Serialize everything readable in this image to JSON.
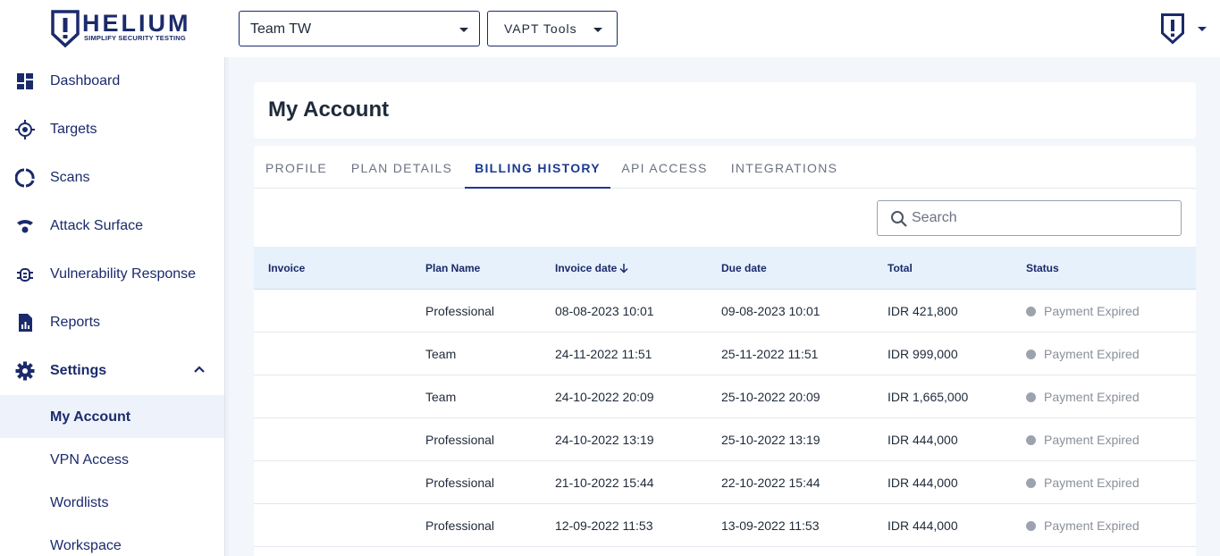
{
  "header": {
    "logo": {
      "word": "HELIUM",
      "tagline": "SIMPLIFY SECURITY TESTING"
    },
    "team_select": {
      "value": "Team TW"
    },
    "tools_select": {
      "value": "VAPT Tools"
    },
    "colors": {
      "brand": "#1b2a6b",
      "accent": "#1b3a8f"
    }
  },
  "sidebar": {
    "items": [
      {
        "label": "Dashboard",
        "icon": "dashboard-icon"
      },
      {
        "label": "Targets",
        "icon": "target-icon"
      },
      {
        "label": "Scans",
        "icon": "scans-icon"
      },
      {
        "label": "Attack Surface",
        "icon": "attack-surface-icon"
      },
      {
        "label": "Vulnerability Response",
        "icon": "bug-icon"
      },
      {
        "label": "Reports",
        "icon": "reports-icon"
      },
      {
        "label": "Settings",
        "icon": "gear-icon",
        "expanded": true
      }
    ],
    "settings_children": [
      {
        "label": "My Account",
        "active": true
      },
      {
        "label": "VPN Access"
      },
      {
        "label": "Wordlists"
      },
      {
        "label": "Workspace"
      }
    ]
  },
  "main": {
    "page_title": "My Account",
    "tabs": [
      {
        "label": "PROFILE"
      },
      {
        "label": "PLAN DETAILS"
      },
      {
        "label": "BILLING HISTORY",
        "active": true
      },
      {
        "label": "API ACCESS"
      },
      {
        "label": "INTEGRATIONS"
      }
    ],
    "search": {
      "placeholder": "Search",
      "value": ""
    },
    "table": {
      "columns": [
        "Invoice",
        "Plan Name",
        "Invoice date",
        "Due date",
        "Total",
        "Status"
      ],
      "sorted_column": "Invoice date",
      "rows": [
        {
          "invoice": "",
          "plan": "Professional",
          "invoice_date": "08-08-2023 10:01",
          "due_date": "09-08-2023 10:01",
          "total": "IDR 421,800",
          "status": "Payment Expired"
        },
        {
          "invoice": "",
          "plan": "Team",
          "invoice_date": "24-11-2022 11:51",
          "due_date": "25-11-2022 11:51",
          "total": "IDR 999,000",
          "status": "Payment Expired"
        },
        {
          "invoice": "",
          "plan": "Team",
          "invoice_date": "24-10-2022 20:09",
          "due_date": "25-10-2022 20:09",
          "total": "IDR 1,665,000",
          "status": "Payment Expired"
        },
        {
          "invoice": "",
          "plan": "Professional",
          "invoice_date": "24-10-2022 13:19",
          "due_date": "25-10-2022 13:19",
          "total": "IDR 444,000",
          "status": "Payment Expired"
        },
        {
          "invoice": "",
          "plan": "Professional",
          "invoice_date": "21-10-2022 15:44",
          "due_date": "22-10-2022 15:44",
          "total": "IDR 444,000",
          "status": "Payment Expired"
        },
        {
          "invoice": "",
          "plan": "Professional",
          "invoice_date": "12-09-2022 11:53",
          "due_date": "13-09-2022 11:53",
          "total": "IDR 444,000",
          "status": "Payment Expired"
        }
      ]
    }
  }
}
